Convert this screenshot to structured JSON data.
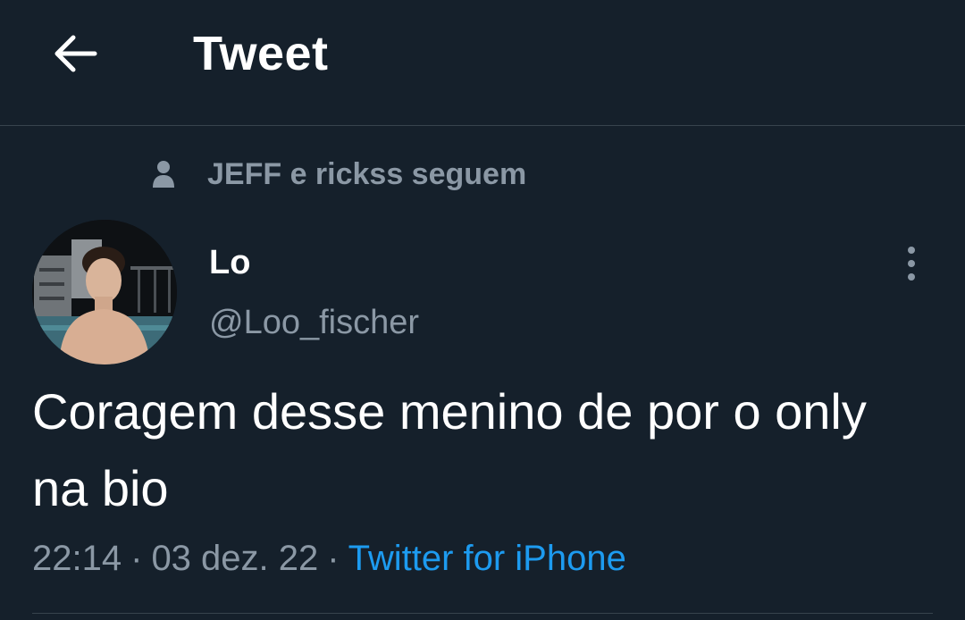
{
  "header": {
    "title": "Tweet",
    "back_icon": "arrow-left-icon"
  },
  "social_context": {
    "icon": "person-icon",
    "text": "JEFF e rickss seguem"
  },
  "tweet": {
    "author_name": "Lo",
    "author_handle": "@Loo_fischer",
    "more_icon": "more-vertical-icon",
    "text": "Coragem desse menino de por o only na bio",
    "time": "22:14",
    "date": "03 dez. 22",
    "separator": "·",
    "source": "Twitter for iPhone"
  },
  "colors": {
    "background": "#15202b",
    "divider": "#38444d",
    "primary_text": "#ffffff",
    "secondary_text": "#8b98a5",
    "accent": "#1d9bf0"
  }
}
